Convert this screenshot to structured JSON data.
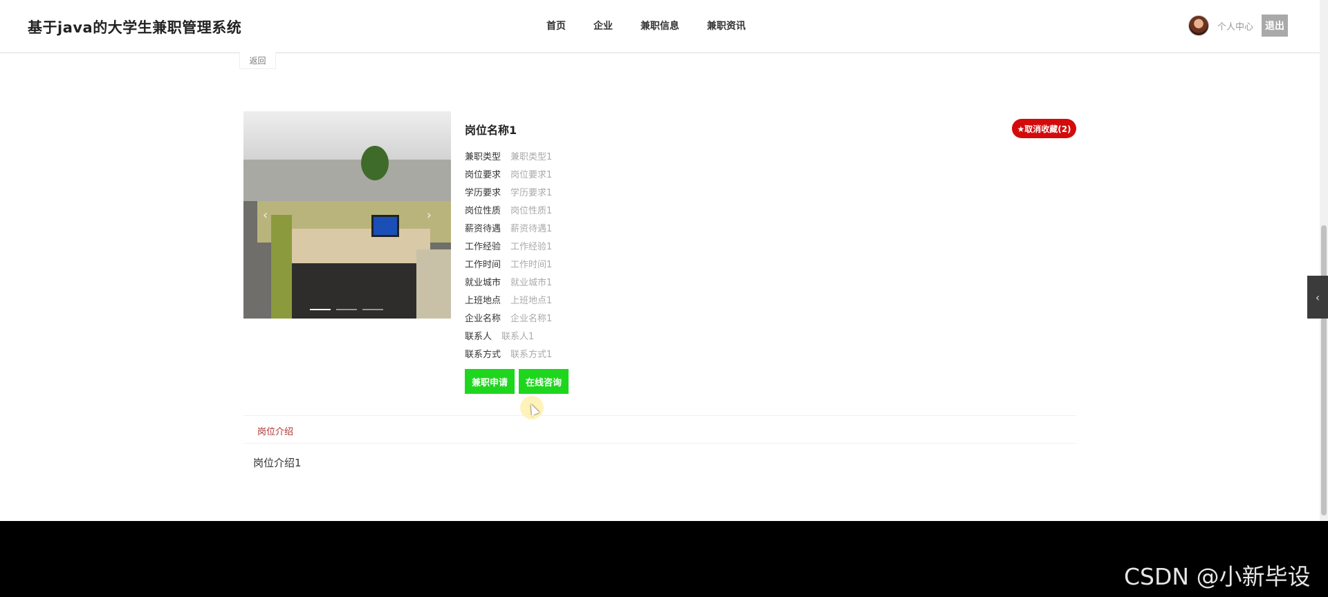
{
  "header": {
    "app_title": "基于java的大学生兼职管理系统",
    "nav": [
      {
        "label": "首页"
      },
      {
        "label": "企业"
      },
      {
        "label": "兼职信息"
      },
      {
        "label": "兼职资讯"
      }
    ],
    "user_center": "个人中心",
    "logout": "退出"
  },
  "back_label": "返回",
  "job": {
    "title": "岗位名称1",
    "favorite_label": "★取消收藏(2)",
    "fields": [
      {
        "label": "兼职类型",
        "value": "兼职类型1"
      },
      {
        "label": "岗位要求",
        "value": "岗位要求1"
      },
      {
        "label": "学历要求",
        "value": "学历要求1"
      },
      {
        "label": "岗位性质",
        "value": "岗位性质1"
      },
      {
        "label": "薪资待遇",
        "value": "薪资待遇1"
      },
      {
        "label": "工作经验",
        "value": "工作经验1"
      },
      {
        "label": "工作时间",
        "value": "工作时间1"
      },
      {
        "label": "就业城市",
        "value": "就业城市1"
      },
      {
        "label": "上班地点",
        "value": "上班地点1"
      },
      {
        "label": "企业名称",
        "value": "企业名称1"
      },
      {
        "label": "联系人",
        "value": "联系人1"
      },
      {
        "label": "联系方式",
        "value": "联系方式1"
      }
    ],
    "apply_label": "兼职申请",
    "consult_label": "在线咨询"
  },
  "tabs": {
    "active_label": "岗位介绍",
    "content": "岗位介绍1"
  },
  "carousel": {
    "arrow_prev": "‹",
    "arrow_next": "›"
  },
  "side_handle_icon": "‹",
  "watermark": "CSDN @小新毕设",
  "colors": {
    "favorite_red": "#d40b0b",
    "action_green": "#1fd61f",
    "tab_active": "#a9322f"
  }
}
